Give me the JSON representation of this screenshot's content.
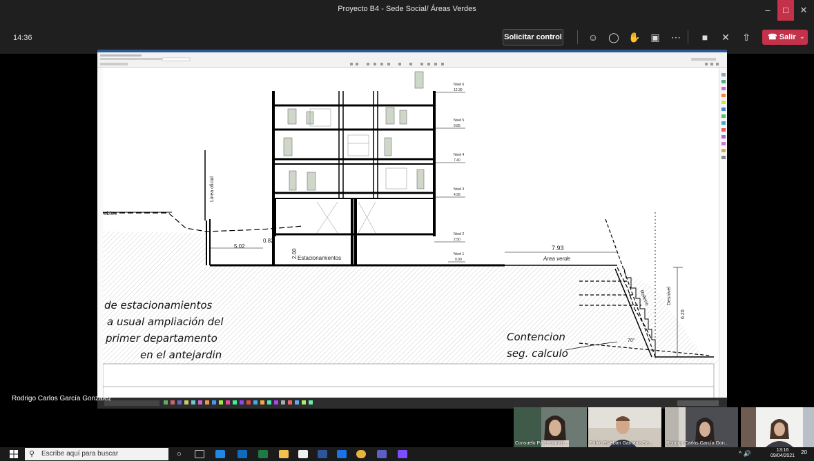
{
  "window": {
    "title": "Proyecto B4 - Sede Social/ Áreas Verdes"
  },
  "meeting": {
    "elapsed": "14:36",
    "request_control": "Solicitar control",
    "leave_label": "Salir",
    "presenter_name": "Rodrigo Carlos García González"
  },
  "participants": [
    {
      "name": "Consuelo Paz Polanco ..."
    },
    {
      "name": "Pablo Esteban Gamarra Sa..."
    },
    {
      "name": "Rodrigo Carlos García Gon..."
    },
    {
      "name": ""
    }
  ],
  "drawing": {
    "levels": [
      {
        "name": "Nivel 6",
        "elev": "12.30"
      },
      {
        "name": "Nivel 5",
        "elev": "9.85"
      },
      {
        "name": "Nivel 4",
        "elev": "7.40"
      },
      {
        "name": "Nivel 3",
        "elev": "4.95"
      },
      {
        "name": "Nivel 2",
        "elev": "2.50"
      },
      {
        "name": "Nivel 1",
        "elev": "0.00"
      }
    ],
    "linea_oficial": "Linea oficial",
    "left_cut_text": "abloe",
    "dim_502": "5.02",
    "dim_082": "0.82",
    "dim_200": "2.00",
    "estacionamientos": "Estacionamientos",
    "dim_793": "7.93",
    "area_verde": "Area verde",
    "relleno": "Relleno",
    "desnivel": "Desnivel",
    "dim_620": "6.20",
    "angle": "70°",
    "note_lines": [
      "de estacionamientos",
      "a usual ampliación del",
      "primer departamento",
      "en el antejardin"
    ],
    "contencion_lines": [
      "Contencion",
      "seg. calculo"
    ]
  },
  "taskbar": {
    "search_placeholder": "Escribe aquí para buscar",
    "time": "13:16",
    "date": "09/04/2021",
    "notifications": "20"
  }
}
